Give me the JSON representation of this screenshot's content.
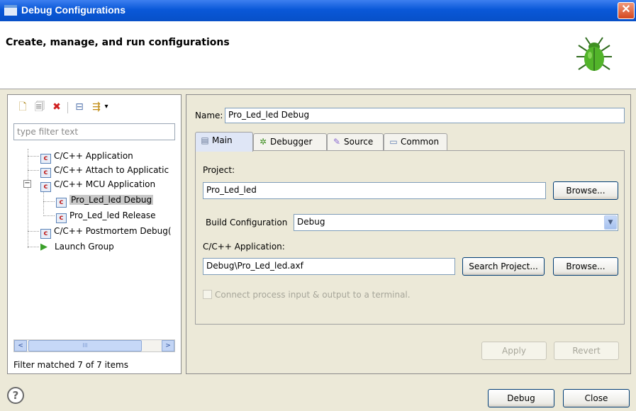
{
  "window": {
    "title": "Debug Configurations",
    "close_glyph": "✕"
  },
  "header": {
    "title": "Create, manage, and run configurations",
    "icon": "bug-icon"
  },
  "left": {
    "toolbar": [
      {
        "name": "new-config-icon",
        "glyph": "🗋"
      },
      {
        "name": "duplicate-icon",
        "glyph": "🗐"
      },
      {
        "name": "delete-icon",
        "glyph": "✖"
      },
      {
        "name": "collapse-all-icon",
        "glyph": "⊟"
      },
      {
        "name": "filter-icon",
        "glyph": "⇶"
      },
      {
        "name": "dropdown-arrow-icon",
        "glyph": "▾"
      }
    ],
    "filter_placeholder": "type filter text",
    "tree": [
      {
        "label": "C/C++ Application",
        "icon": "c-config-icon",
        "glyph": "c",
        "level": 0
      },
      {
        "label": "C/C++ Attach to Applicatic",
        "icon": "c-config-icon",
        "glyph": "c",
        "level": 0
      },
      {
        "label": "C/C++ MCU Application",
        "icon": "c-config-icon",
        "glyph": "c",
        "level": 0,
        "expanded": true
      },
      {
        "label": "Pro_Led_led Debug",
        "icon": "c-config-icon",
        "glyph": "c",
        "level": 1,
        "selected": true
      },
      {
        "label": "Pro_Led_led Release",
        "icon": "c-config-icon",
        "glyph": "c",
        "level": 1
      },
      {
        "label": "C/C++ Postmortem Debug(",
        "icon": "c-config-icon",
        "glyph": "c",
        "level": 0
      },
      {
        "label": "Launch Group",
        "icon": "launch-group-icon",
        "glyph": "▶",
        "level": 0
      }
    ],
    "expander_glyph": "−",
    "scroll": {
      "left": "<",
      "right": ">",
      "thumb": "III"
    },
    "status": "Filter matched 7 of 7 items"
  },
  "right": {
    "name_label": "Name:",
    "name_value": "Pro_Led_led Debug",
    "tabs": [
      {
        "label": "Main",
        "icon": "main-tab-icon",
        "glyph": "▤",
        "active": true
      },
      {
        "label": "Debugger",
        "icon": "debugger-tab-icon",
        "glyph": "✲"
      },
      {
        "label": "Source",
        "icon": "source-tab-icon",
        "glyph": "✎"
      },
      {
        "label": "Common",
        "icon": "common-tab-icon",
        "glyph": "▭"
      }
    ],
    "project_label": "Project:",
    "project_value": "Pro_Led_led",
    "browse_label": "Browse...",
    "build_config_label": "Build Configuration",
    "build_config_value": "Debug",
    "app_label": "C/C++ Application:",
    "app_value": "Debug\\Pro_Led_led.axf",
    "search_project_label": "Search Project...",
    "checkbox_label": "Connect process input & output to a terminal.",
    "apply_label": "Apply",
    "revert_label": "Revert"
  },
  "footer": {
    "debug_label": "Debug",
    "close_label": "Close",
    "help_glyph": "?"
  }
}
